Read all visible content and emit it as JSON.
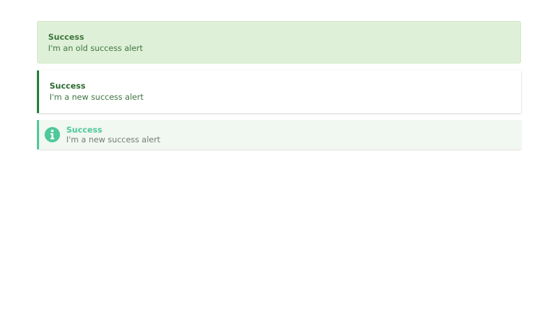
{
  "alerts": {
    "old": {
      "title": "Success",
      "message": "I'm an old success alert"
    },
    "new": {
      "title": "Success",
      "message": "I'm a new success alert"
    },
    "icon_variant": {
      "title": "Success",
      "message": "I'm a new success alert",
      "icon": "info-circle-icon"
    }
  },
  "colors": {
    "old_background": "#dff0d8",
    "old_text": "#3c763d",
    "new_border": "#1e7e34",
    "icon_accent": "#4fc89b",
    "icon_background": "#f1f8f1"
  }
}
